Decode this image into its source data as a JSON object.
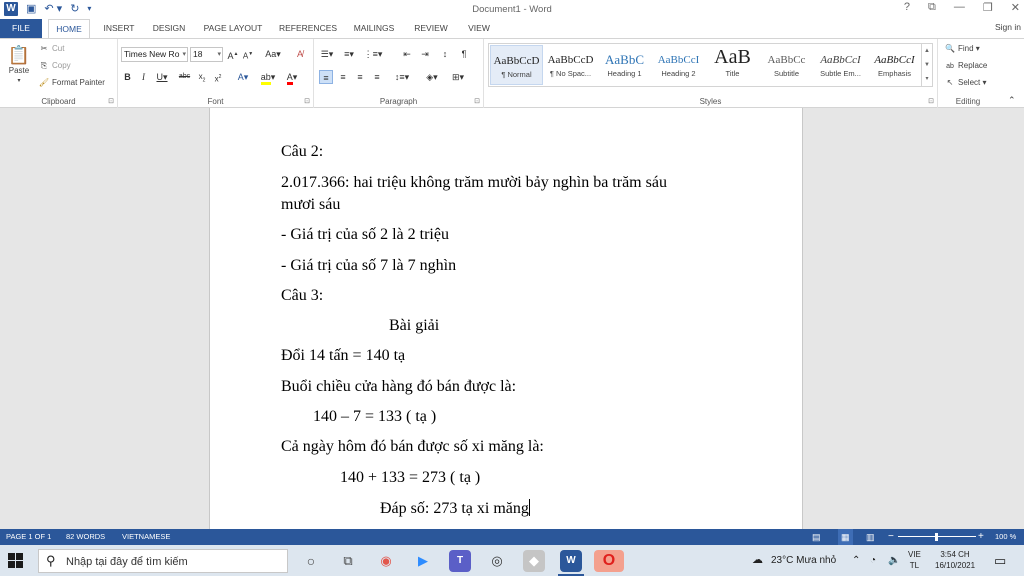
{
  "window": {
    "title": "Document1 - Word",
    "controls": [
      "?",
      "⧉",
      "—",
      "❐",
      "✕"
    ],
    "app_icon_letter": "W"
  },
  "tabs": {
    "file": "FILE",
    "items": [
      "HOME",
      "INSERT",
      "DESIGN",
      "PAGE LAYOUT",
      "REFERENCES",
      "MAILINGS",
      "REVIEW",
      "VIEW"
    ],
    "active": "HOME",
    "signin": "Sign in"
  },
  "ribbon": {
    "clipboard": {
      "label": "Clipboard",
      "paste": "Paste",
      "cut": "Cut",
      "copy": "Copy",
      "format_painter": "Format Painter"
    },
    "font": {
      "label": "Font",
      "font_name": "Times New Ro",
      "font_size": "18"
    },
    "paragraph": {
      "label": "Paragraph"
    },
    "styles": {
      "label": "Styles",
      "items": [
        {
          "preview": "AaBbCcD",
          "name": "¶ Normal"
        },
        {
          "preview": "AaBbCcD",
          "name": "¶ No Spac..."
        },
        {
          "preview": "AaBbC",
          "name": "Heading 1"
        },
        {
          "preview": "AaBbCcI",
          "name": "Heading 2"
        },
        {
          "preview": "AaB",
          "name": "Title"
        },
        {
          "preview": "AaBbCc",
          "name": "Subtitle"
        },
        {
          "preview": "AaBbCcI",
          "name": "Subtle Em..."
        },
        {
          "preview": "AaBbCcI",
          "name": "Emphasis"
        }
      ]
    },
    "editing": {
      "label": "Editing",
      "find": "Find",
      "replace": "Replace",
      "select": "Select"
    }
  },
  "document": {
    "lines": [
      "Câu 2:",
      "2.017.366: hai triệu không trăm mười bảy nghìn ba trăm sáu",
      "mươi sáu",
      "- Giá trị của số 2 là 2 triệu",
      "- Giá trị của số 7 là 7 nghìn",
      "Câu 3:",
      "Bài giải",
      "Đổi 14 tấn = 140 tạ",
      "Buổi chiều cửa hàng đó bán được là:",
      "140 – 7 = 133 ( tạ )",
      "Cả ngày hôm đó bán được số xi măng là:",
      "140 + 133 = 273 ( tạ )",
      "Đáp số: 273 tạ xi măng"
    ]
  },
  "status": {
    "page": "PAGE 1 OF 1",
    "words": "82 WORDS",
    "language": "VIETNAMESE",
    "zoom": "100 %",
    "zoom_minus": "−",
    "zoom_plus": "+"
  },
  "taskbar": {
    "search_placeholder": "Nhập tại đây để tìm kiếm",
    "weather": "23°C  Mưa nhỏ",
    "lang_line1": "VIE",
    "lang_line2": "TL",
    "time": "3:54 CH",
    "date": "16/10/2021"
  },
  "colors": {
    "accent": "#2b579a",
    "taskbar": "#dde6ef"
  }
}
